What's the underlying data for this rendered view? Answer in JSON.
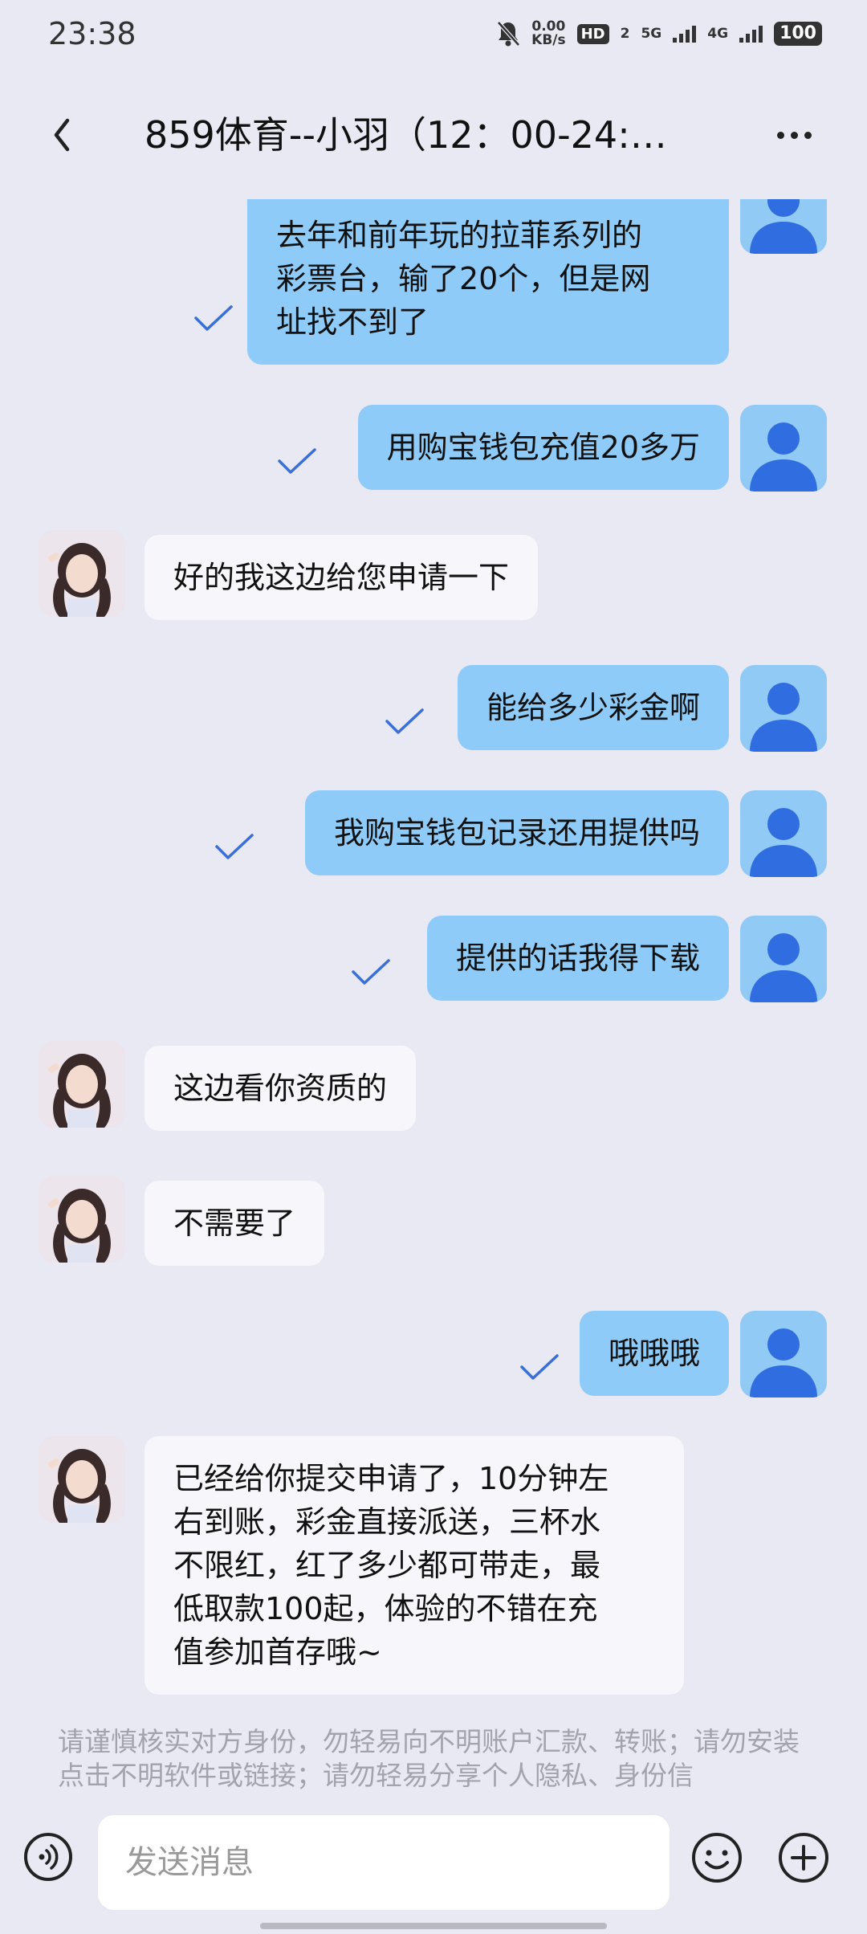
{
  "status_bar": {
    "time": "23:38",
    "net_speed_value": "0.00",
    "net_speed_unit": "KB/s",
    "hd_label": "HD",
    "sim_label": "2",
    "signal_5g": "5G",
    "signal_4g": "4G",
    "battery": "100"
  },
  "header": {
    "title": "859体育--小羽（12：00-24:…"
  },
  "messages": [
    {
      "sender": "me",
      "text": "去年和前年玩的拉菲系列的\n彩票台，输了20个，但是网\n址找不到了"
    },
    {
      "sender": "me",
      "text": "用购宝钱包充值20多万"
    },
    {
      "sender": "agent",
      "text": "好的我这边给您申请一下"
    },
    {
      "sender": "me",
      "text": "能给多少彩金啊"
    },
    {
      "sender": "me",
      "text": "我购宝钱包记录还用提供吗"
    },
    {
      "sender": "me",
      "text": "提供的话我得下载"
    },
    {
      "sender": "agent",
      "text": "这边看你资质的"
    },
    {
      "sender": "agent",
      "text": "不需要了"
    },
    {
      "sender": "me",
      "text": "哦哦哦"
    },
    {
      "sender": "agent",
      "text": "已经给你提交申请了，10分钟左\n右到账，彩金直接派送，三杯水\n不限红，红了多少都可带走，最\n低取款100起，体验的不错在充\n值参加首存哦~"
    }
  ],
  "warning": {
    "text": "请谨慎核实对方身份，勿轻易向不明账户汇款、转账；请勿安装点击不明软件或链接；请勿轻易分享个人隐私、身份信"
  },
  "input_bar": {
    "placeholder": "发送消息"
  },
  "colors": {
    "background": "#e9e9f3",
    "my_bubble": "#8fcbf8",
    "agent_bubble": "#f7f7fb",
    "avatar_icon": "#2f6de0",
    "check": "#3a6fd6"
  },
  "icons": {
    "back": "chevron-left-icon",
    "more": "more-horizontal-icon",
    "voice": "voice-icon",
    "emoji": "emoji-icon",
    "plus": "plus-icon",
    "read": "check-icon",
    "my_avatar": "person-icon"
  }
}
